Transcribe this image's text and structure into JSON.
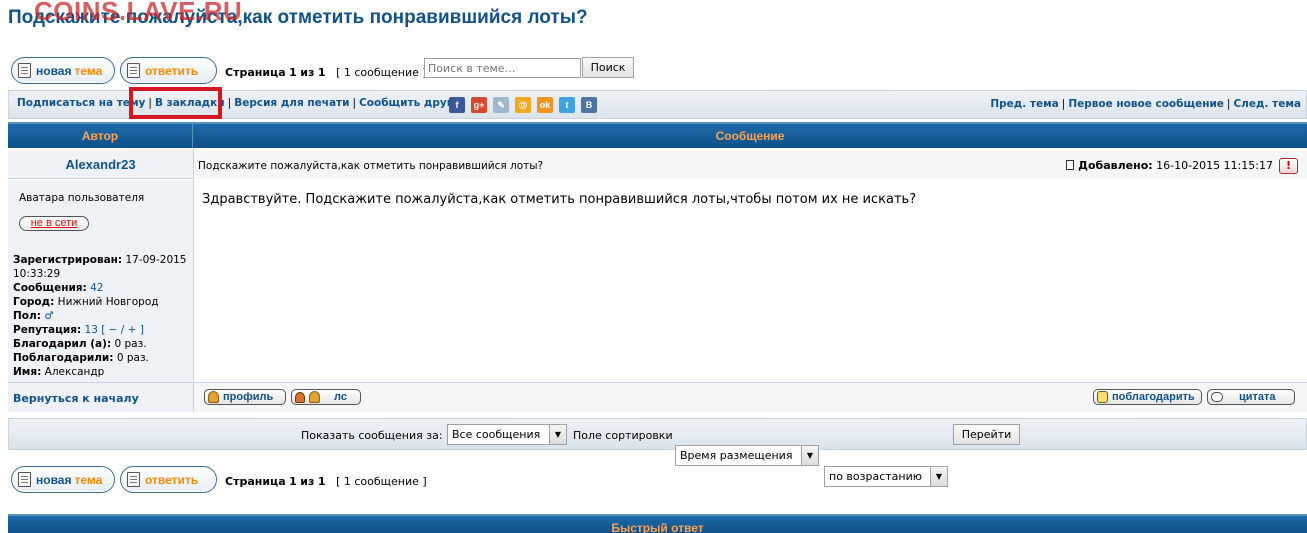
{
  "page": {
    "title": "Подскажите пожалуйста,как отметить понравившийся лоты?",
    "watermark": "COINS.LAVE.RU"
  },
  "actions": {
    "new_topic_1": "новая",
    "new_topic_2": "тема",
    "reply": "ответить"
  },
  "pagination": {
    "prefix": "Страница",
    "current": "1",
    "of": "из",
    "total": "1",
    "count": "[ 1 сообщение ]"
  },
  "search": {
    "placeholder": "Поиск в теме…",
    "button": "Поиск"
  },
  "nav": {
    "subscribe": "Подписаться на тему",
    "bookmark": "В закладки",
    "print": "Версия для печати",
    "email": "Сообщить другу",
    "prev": "Пред. тема",
    "first_new": "Первое новое сообщение",
    "next": "След. тема",
    "social": [
      {
        "name": "facebook-icon",
        "glyph": "f",
        "color": "#3b5998"
      },
      {
        "name": "google-plus-icon",
        "glyph": "g+",
        "color": "#d6492f"
      },
      {
        "name": "livejournal-icon",
        "glyph": "✎",
        "color": "#9fb8cf"
      },
      {
        "name": "mailru-icon",
        "glyph": "@",
        "color": "#f0a823"
      },
      {
        "name": "odnoklassniki-icon",
        "glyph": "ok",
        "color": "#f29520"
      },
      {
        "name": "twitter-icon",
        "glyph": "t",
        "color": "#3ea3dd"
      },
      {
        "name": "vkontakte-icon",
        "glyph": "В",
        "color": "#4c75a3"
      }
    ]
  },
  "table": {
    "col_author": "Автор",
    "col_message": "Сообщение"
  },
  "post": {
    "author": "Alexandr23",
    "subject": "Подскажите пожалуйста,как отметить понравившийся лоты?",
    "date_label": "Добавлено:",
    "date": "16-10-2015 11:15:17",
    "report": "!",
    "avatar_text": "Аватара пользователя",
    "status": "не в сети",
    "registered_label": "Зарегистрирован:",
    "registered_date": "17-09-2015",
    "registered_time": "10:33:29",
    "posts_label": "Сообщения:",
    "posts": "42",
    "city_label": "Город:",
    "city": "Нижний Новгород",
    "gender_label": "Пол:",
    "gender": "♂",
    "reputation_label": "Репутация:",
    "reputation": "13",
    "reputation_controls": "[ − / + ]",
    "thanked_label": "Благодарил (а):",
    "thanked": "0 раз.",
    "thanks_received_label": "Поблагодарили:",
    "thanks_received": "0 раз.",
    "name_label": "Имя:",
    "name": "Александр",
    "body": "Здравствуйте. Подскажите пожалуйста,как отметить понравившийся лоты,чтобы потом их не искать?",
    "back_to_top": "Вернуться к началу",
    "btn_profile": "профиль",
    "btn_pm": "лс",
    "btn_thank": "поблагодарить",
    "btn_quote": "цитата"
  },
  "sort": {
    "show_label": "Показать сообщения за:",
    "show_value": "Все сообщения",
    "sort_label": "Поле сортировки",
    "sort_value": "Время размещения",
    "order_value": "по возрастанию",
    "go": "Перейти"
  },
  "quick_reply": {
    "title": "Быстрый ответ"
  },
  "colors": {
    "link": "#105289",
    "header_bg": "#0f5089",
    "header_text": "#ffa34f",
    "highlight": "#d4171e"
  }
}
